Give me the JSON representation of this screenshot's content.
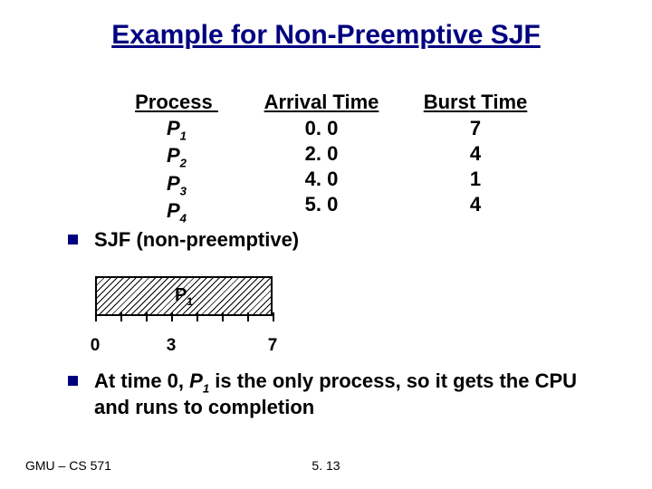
{
  "title": "Example for Non-Preemptive SJF",
  "table": {
    "headers": {
      "process": "Process ",
      "arrival": "Arrival Time",
      "burst": "Burst Time"
    },
    "rows": [
      {
        "process_base": "P",
        "process_sub": "1",
        "arrival": "0. 0",
        "burst": "7"
      },
      {
        "process_base": "P",
        "process_sub": "2",
        "arrival": "2. 0",
        "burst": "4"
      },
      {
        "process_base": "P",
        "process_sub": "3",
        "arrival": "4. 0",
        "burst": "1"
      },
      {
        "process_base": "P",
        "process_sub": "4",
        "arrival": "5. 0",
        "burst": "4"
      }
    ]
  },
  "bullet1": "SJF (non-preemptive)",
  "gantt": {
    "segment_label_base": "P",
    "segment_label_sub": "1",
    "segment_width_units": 7,
    "tick_marks": [
      0,
      1,
      2,
      3,
      4,
      5,
      6,
      7
    ],
    "tick_labels": [
      {
        "pos": 0,
        "text": "0"
      },
      {
        "pos": 3,
        "text": "3"
      },
      {
        "pos": 7,
        "text": "7"
      }
    ]
  },
  "bullet2_prefix": "At time 0, ",
  "bullet2_proc_base": "P",
  "bullet2_proc_sub": "1",
  "bullet2_suffix": " is the only process, so it gets the CPU and runs to completion",
  "footer_left": "GMU – CS 571",
  "footer_center": "5. 13",
  "chart_data": {
    "type": "table",
    "title": "Process arrival and burst times (Non-preemptive SJF example)",
    "columns": [
      "Process",
      "Arrival Time",
      "Burst Time"
    ],
    "rows": [
      [
        "P1",
        0.0,
        7
      ],
      [
        "P2",
        2.0,
        4
      ],
      [
        "P3",
        4.0,
        1
      ],
      [
        "P4",
        5.0,
        4
      ]
    ],
    "gantt": {
      "segments": [
        {
          "process": "P1",
          "start": 0,
          "end": 7
        }
      ],
      "axis_ticks": [
        0,
        1,
        2,
        3,
        4,
        5,
        6,
        7
      ],
      "labeled_ticks": [
        0,
        3,
        7
      ]
    }
  }
}
